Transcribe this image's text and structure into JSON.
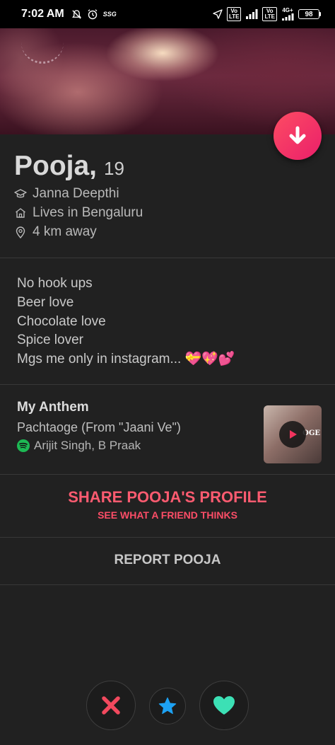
{
  "status_bar": {
    "time": "7:02 AM",
    "ssg": "SSG",
    "volte": "Vo\nLTE",
    "volte2": "Vo\nLTE",
    "network": "4G+",
    "battery": "98"
  },
  "profile": {
    "name": "Pooja,",
    "age": "19",
    "school": "Janna Deepthi",
    "city": "Lives in Bengaluru",
    "distance": "4 km away"
  },
  "bio": {
    "lines": [
      "No hook ups",
      "Beer love",
      "Chocolate love",
      "Spice lover",
      "Mgs me only in instagram..."
    ],
    "emojis": "💝💖💕"
  },
  "anthem": {
    "section_title": "My Anthem",
    "song": "Pachtaoge (From \"Jaani Ve\")",
    "artists": "Arijit Singh, B Praak",
    "album_text": "OGE"
  },
  "share": {
    "title": "SHARE POOJA'S PROFILE",
    "subtitle": "SEE WHAT A FRIEND THINKS"
  },
  "report": {
    "label": "REPORT POOJA"
  },
  "colors": {
    "brand_gradient_start": "#fd4c63",
    "brand_gradient_end": "#ea1f6a",
    "nope": "#f2495e",
    "super_like": "#1da1f2",
    "like": "#3ce0b5",
    "background": "#212121"
  },
  "icons": {
    "collapse": "arrow-down-icon",
    "school": "graduation-cap-icon",
    "city": "home-icon",
    "distance": "location-pin-icon",
    "spotify": "spotify-icon",
    "nope": "close-icon",
    "super_like": "star-icon",
    "like": "heart-icon"
  }
}
